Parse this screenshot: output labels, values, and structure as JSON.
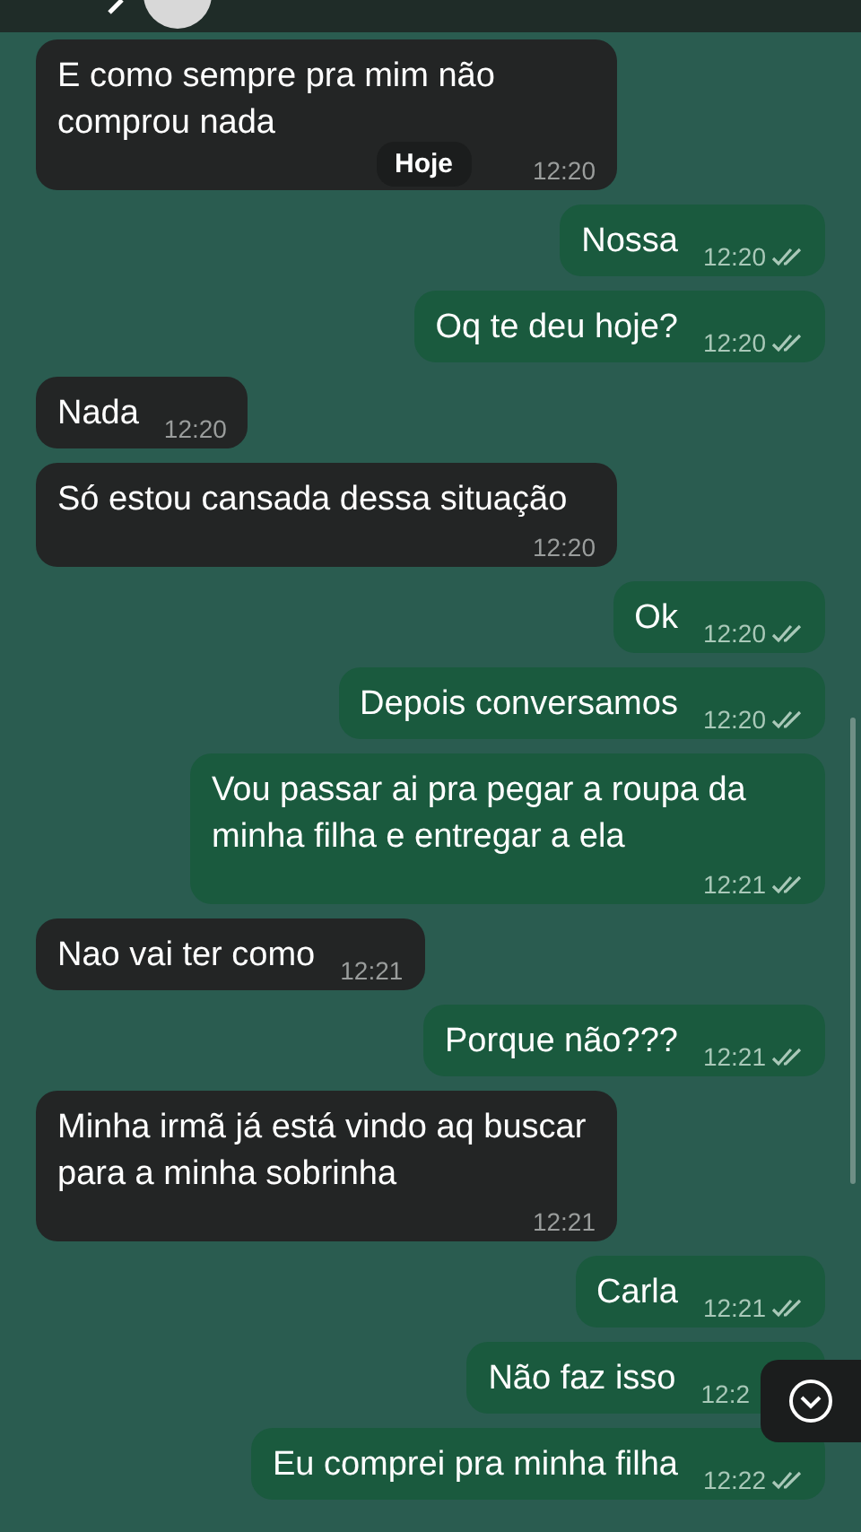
{
  "date_pill": "Hoje",
  "messages": [
    {
      "kind": "incoming",
      "text": "E como sempre pra mim não comprou nada",
      "time": "12:20"
    },
    {
      "kind": "outgoing",
      "text": "Nossa",
      "time": "12:20",
      "read": true
    },
    {
      "kind": "outgoing",
      "text": "Oq te deu hoje?",
      "time": "12:20",
      "read": true
    },
    {
      "kind": "incoming",
      "text": "Nada",
      "time": "12:20"
    },
    {
      "kind": "incoming",
      "text": "Só estou cansada dessa situação",
      "time": "12:20"
    },
    {
      "kind": "outgoing",
      "text": "Ok",
      "time": "12:20",
      "read": true
    },
    {
      "kind": "outgoing",
      "text": "Depois conversamos",
      "time": "12:20",
      "read": true
    },
    {
      "kind": "outgoing",
      "text": "Vou passar ai pra pegar a roupa da minha filha e entregar a ela",
      "time": "12:21",
      "read": true
    },
    {
      "kind": "incoming",
      "text": "Nao vai ter como",
      "time": "12:21"
    },
    {
      "kind": "outgoing",
      "text": "Porque não???",
      "time": "12:21",
      "read": true
    },
    {
      "kind": "incoming",
      "text": "Minha irmã já está vindo aq buscar para a minha sobrinha",
      "time": "12:21"
    },
    {
      "kind": "outgoing",
      "text": "Carla",
      "time": "12:21",
      "read": true
    },
    {
      "kind": "outgoing",
      "text": "Não faz isso",
      "time": "12:2"
    },
    {
      "kind": "outgoing",
      "text": "Eu comprei pra minha filha",
      "time": "12:22",
      "read": true
    }
  ]
}
